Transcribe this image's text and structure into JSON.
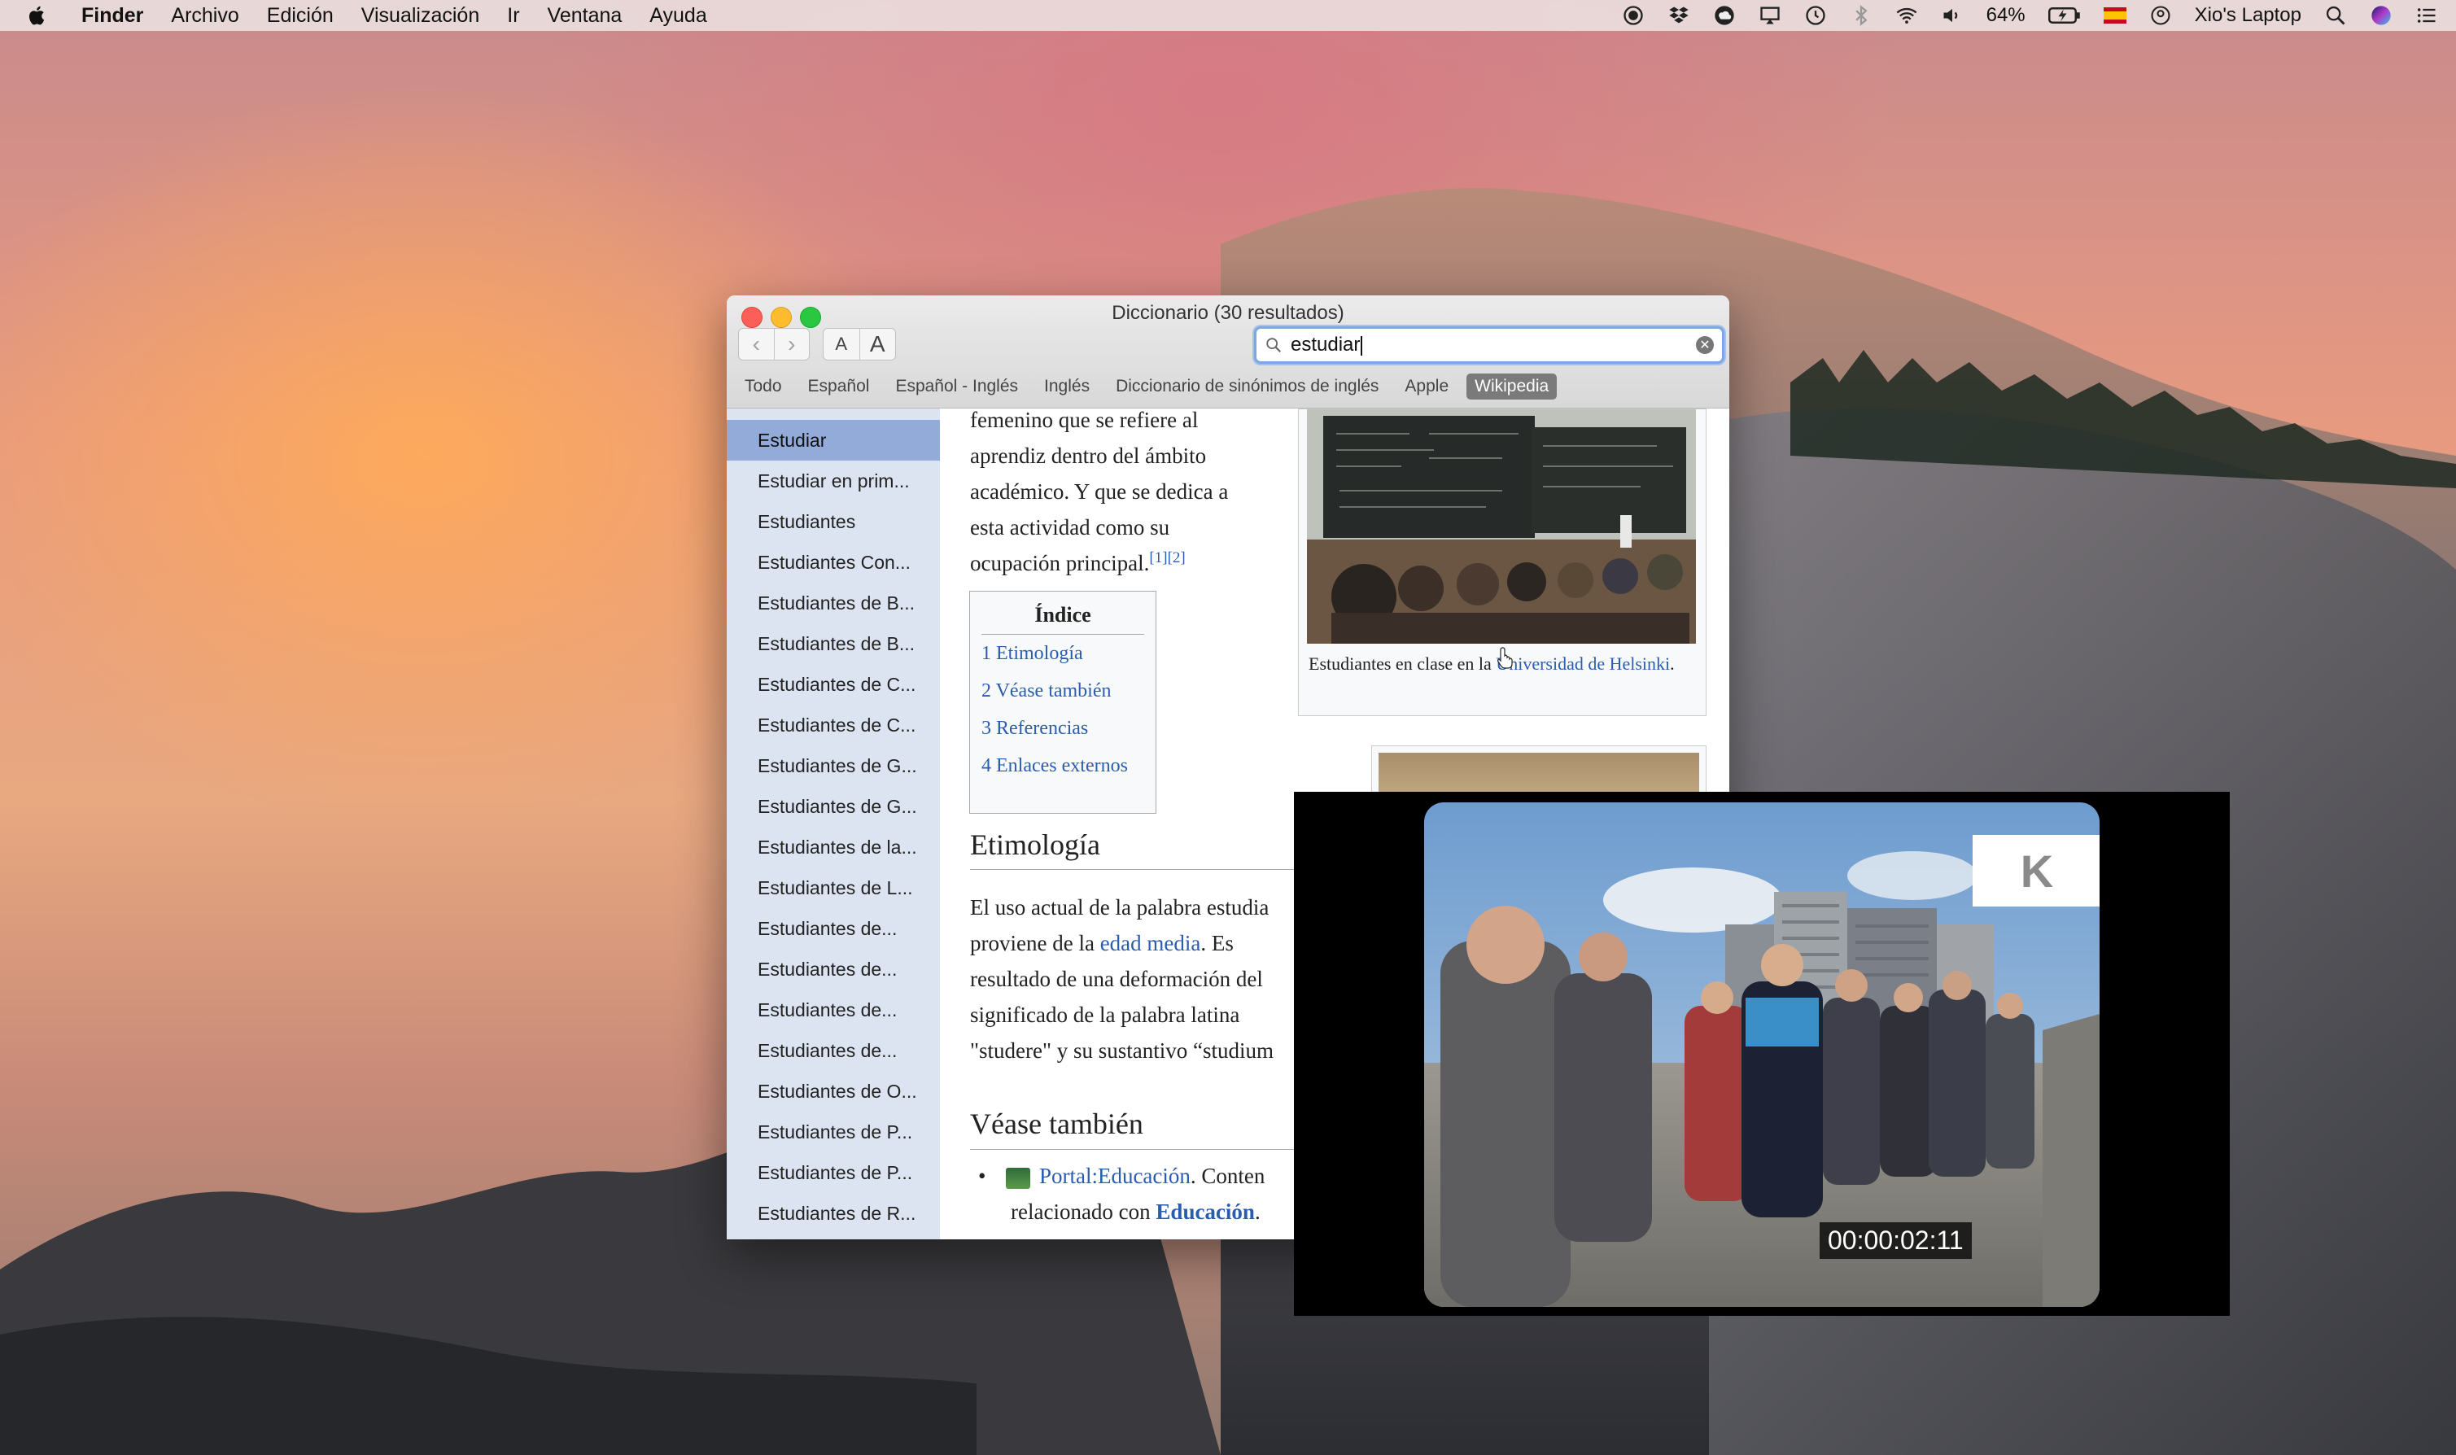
{
  "menubar": {
    "app_name": "Finder",
    "items": [
      "Archivo",
      "Edición",
      "Visualización",
      "Ir",
      "Ventana",
      "Ayuda"
    ],
    "battery": "64%",
    "computer_name": "Xio's Laptop"
  },
  "dictionary": {
    "title": "Diccionario (30 resultados)",
    "search_value": "estudiar",
    "font_small": "A",
    "font_large": "A",
    "tabs": [
      "Todo",
      "Español",
      "Español - Inglés",
      "Inglés",
      "Diccionario de sinónimos de inglés",
      "Apple",
      "Wikipedia"
    ],
    "active_tab": "Wikipedia",
    "results": [
      "Estudiar",
      "Estudiar en prim...",
      "Estudiantes",
      "Estudiantes Con...",
      "Estudiantes de B...",
      "Estudiantes de B...",
      "Estudiantes de C...",
      "Estudiantes de C...",
      "Estudiantes de G...",
      "Estudiantes de G...",
      "Estudiantes de la...",
      "Estudiantes de L...",
      "Estudiantes de...",
      "Estudiantes de...",
      "Estudiantes de...",
      "Estudiantes de...",
      "Estudiantes de O...",
      "Estudiantes de P...",
      "Estudiantes de P...",
      "Estudiantes de R..."
    ],
    "article": {
      "intro_lines": [
        "femenino que se refiere al",
        "aprendiz dentro del ámbito",
        "académico. Y que se dedica a",
        "esta actividad como su",
        "ocupación principal."
      ],
      "intro_refs": "[1][2]",
      "toc_title": "Índice",
      "toc": [
        "1 Etimología",
        "2 Véase también",
        "3 Referencias",
        "4 Enlaces externos"
      ],
      "etimologia_heading": "Etimología",
      "etim_l1": "El uso actual de la palabra estudia",
      "etim_l2_pre": "proviene de la ",
      "etim_l2_link": "edad media",
      "etim_l2_post": ". Es",
      "etim_l3": "resultado de una deformación del",
      "etim_l4": "significado de la palabra latina",
      "etim_l5": "\"studere\" y su sustantivo “studium",
      "vease_heading": "Véase también",
      "bullet_link": "Portal:Educación",
      "bullet_text": ". Conten",
      "bullet_line2_pre": "relacionado con ",
      "bullet_line2_link": "Educación",
      "bullet_line2_post": ".",
      "caption_pre": "Estudiantes en clase en la ",
      "caption_link": "Universidad de Helsinki",
      "caption_post": "."
    }
  },
  "video": {
    "logo": "K",
    "timecode": "00:00:02:11"
  }
}
